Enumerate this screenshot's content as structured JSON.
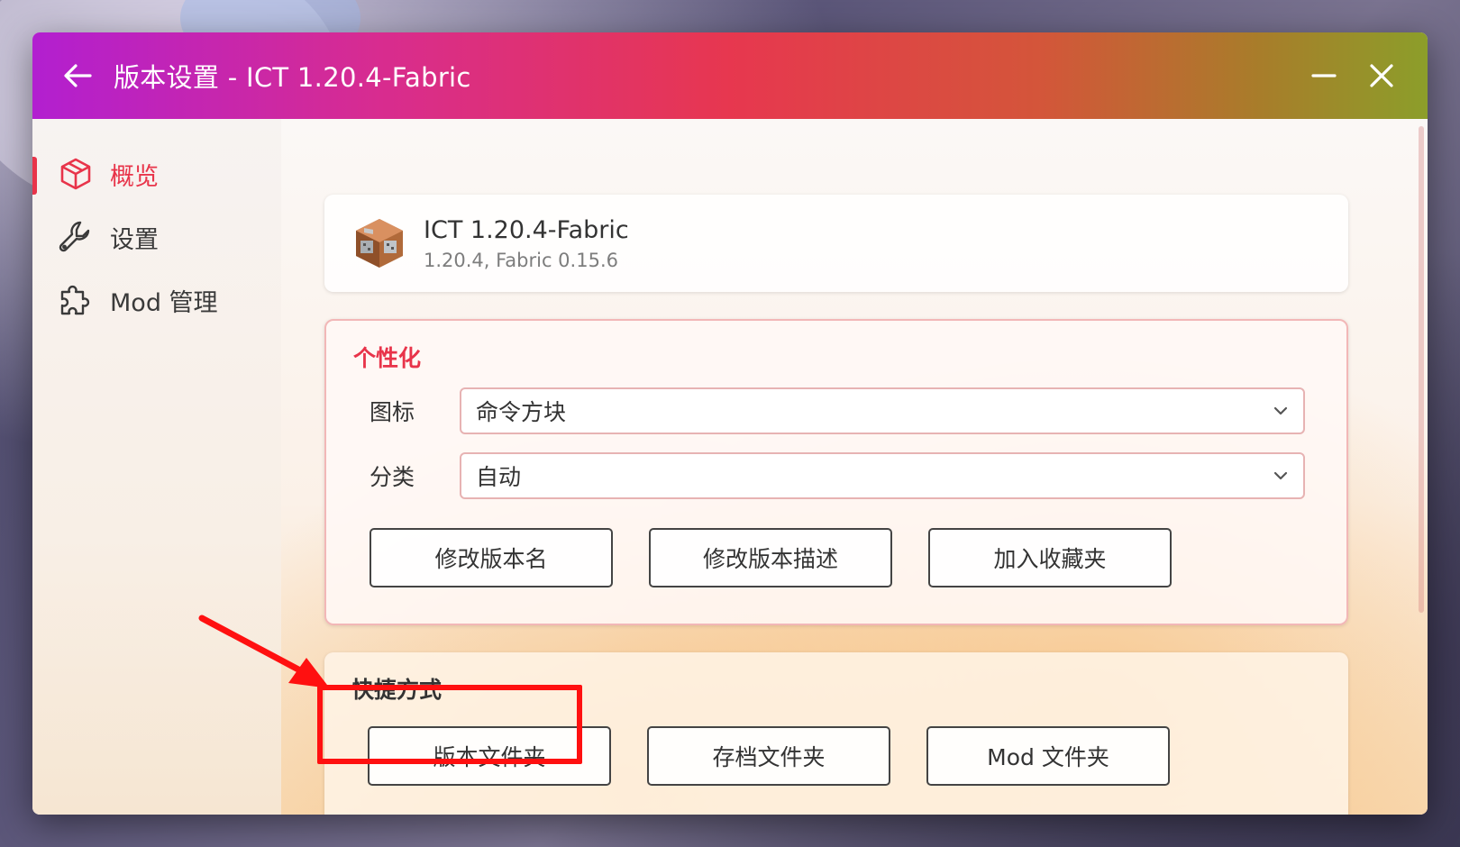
{
  "titlebar": {
    "title": "版本设置 - ICT 1.20.4-Fabric",
    "back_icon": "arrow-left-icon",
    "minimize_icon": "minimize-icon",
    "close_icon": "close-icon"
  },
  "sidebar": {
    "items": [
      {
        "label": "概览",
        "icon": "cube-icon",
        "active": true
      },
      {
        "label": "设置",
        "icon": "wrench-icon",
        "active": false
      },
      {
        "label": "Mod 管理",
        "icon": "puzzle-icon",
        "active": false
      }
    ]
  },
  "version_card": {
    "name": "ICT 1.20.4-Fabric",
    "description": "1.20.4, Fabric 0.15.6",
    "icon": "command-block-icon"
  },
  "personalize": {
    "title": "个性化",
    "icon_label": "图标",
    "icon_value": "命令方块",
    "category_label": "分类",
    "category_value": "自动",
    "buttons": [
      "修改版本名",
      "修改版本描述",
      "加入收藏夹"
    ]
  },
  "shortcuts": {
    "title": "快捷方式",
    "buttons": [
      "版本文件夹",
      "存档文件夹",
      "Mod 文件夹"
    ]
  },
  "colors": {
    "accent": "#e8344a",
    "highlight": "#ff1010"
  }
}
